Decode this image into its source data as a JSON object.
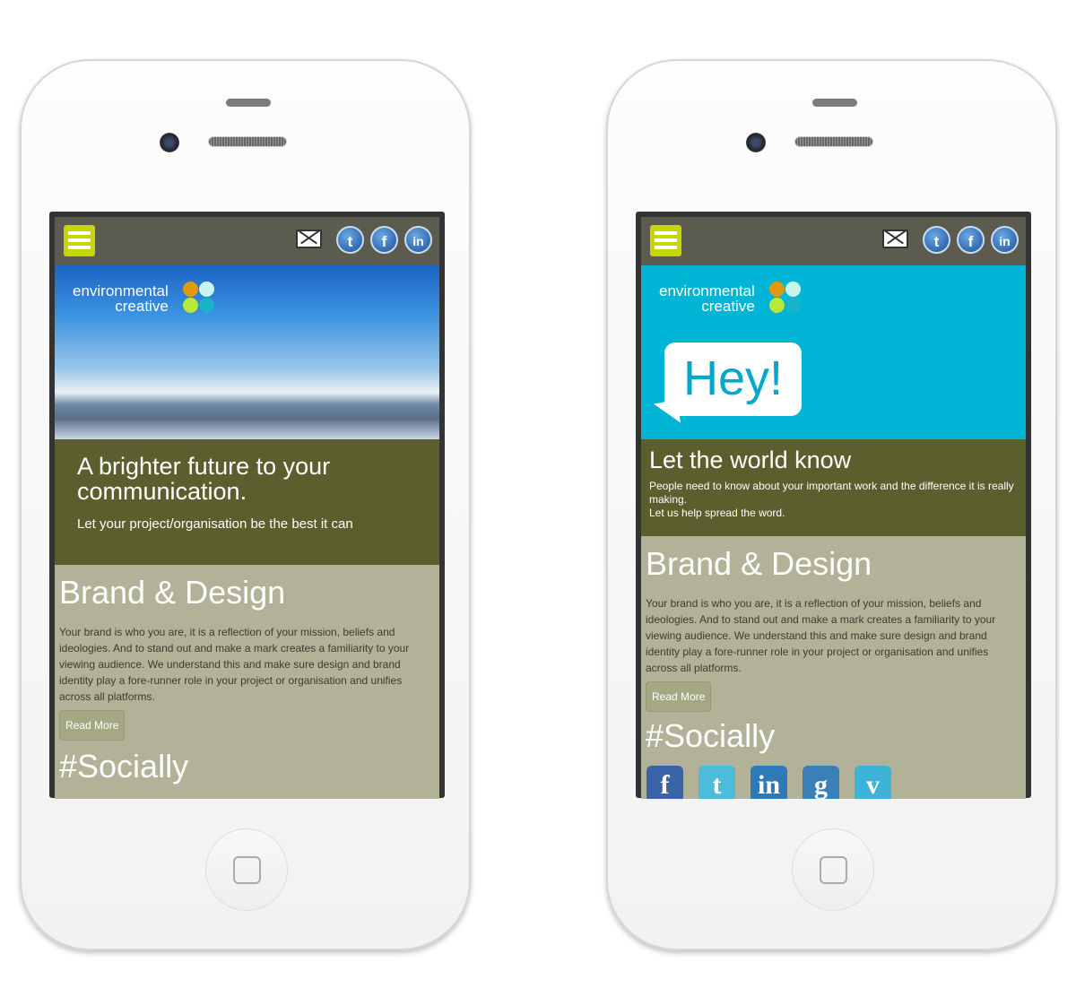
{
  "logo": {
    "line1": "environmental",
    "line2": "creative"
  },
  "header_icons": [
    "menu-icon",
    "mail-icon",
    "twitter-icon",
    "facebook-icon",
    "linkedin-icon"
  ],
  "colors": {
    "menu": "#c5d600",
    "header": "#5b5b50",
    "olive": "#5b5f2e",
    "khaki": "#b1b298",
    "cyan": "#00b4d6"
  },
  "left": {
    "headline": "A brighter future to your communication.",
    "subline": "Let your project/organisation be the best it can",
    "brand_title": "Brand & Design",
    "brand_text": "Your brand is who you are, it is a reflection of your mission, beliefs and ideologies. And to stand out and make a mark creates a familiarity to your viewing audience. We understand this and make sure design and brand identity play a fore-runner role in your project or organisation and unifies across all platforms.",
    "read_more": "Read More",
    "socially": "#Socially"
  },
  "right": {
    "bubble": "Hey!",
    "headline": "Let the world know",
    "text1": "People need to know about your important work and the difference it is really making.",
    "text2": "Let us help spread the word.",
    "brand_title": "Brand & Design",
    "brand_text": "Your brand is who you are, it is a reflection of your mission, beliefs and ideologies. And to stand out and make a mark creates a familiarity to your viewing audience. We understand this and make sure design and brand identity play a fore-runner role in your project or organisation and unifies across all platforms.",
    "read_more": "Read More",
    "socially": "#Socially",
    "social_icons": [
      {
        "name": "facebook",
        "glyph": "f",
        "color": "#3b64a8"
      },
      {
        "name": "twitter",
        "glyph": "t",
        "color": "#4cbcd8"
      },
      {
        "name": "linkedin",
        "glyph": "in",
        "color": "#2e7ab8"
      },
      {
        "name": "google",
        "glyph": "g",
        "color": "#3a7fb8"
      },
      {
        "name": "vimeo",
        "glyph": "v",
        "color": "#3fb2d8"
      }
    ]
  }
}
